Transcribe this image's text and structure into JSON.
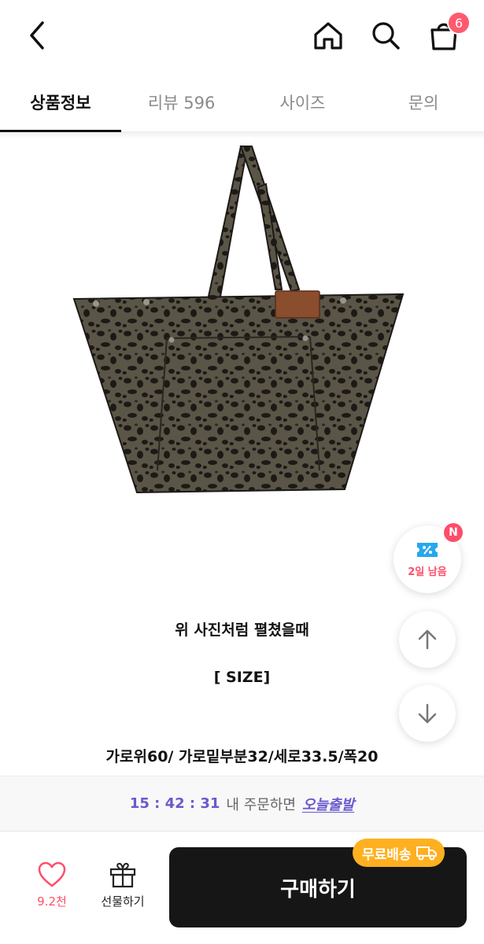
{
  "header": {
    "cart_count": "6",
    "icons": [
      "back-arrow-icon",
      "home-icon",
      "search-icon",
      "shopping-bag-icon"
    ]
  },
  "tabs": [
    {
      "label": "상품정보",
      "active": true
    },
    {
      "label": "리뷰 596",
      "active": false
    },
    {
      "label": "사이즈",
      "active": false
    },
    {
      "label": "문의",
      "active": false
    }
  ],
  "coupon": {
    "badge": "N",
    "label": "2일 남음",
    "icon": "coupon-percent-icon"
  },
  "floating": {
    "scroll_up_icon": "arrow-up-icon",
    "scroll_down_icon": "arrow-down-icon"
  },
  "description": {
    "line1": "위 사진처럼 펼쳤을때",
    "line2": "[ SIZE]",
    "line3": "가로위60/ 가로밑부분32/세로33.5/폭20"
  },
  "shipping": {
    "time": "15 : 42 : 31",
    "text": "내 주문하면",
    "today": "오늘출발"
  },
  "bottom": {
    "like_count": "9.2천",
    "gift_label": "선물하기",
    "buy_label": "구매하기",
    "free_shipping": "무료배송"
  },
  "colors": {
    "accent_pink": "#ff4d6a",
    "accent_purple": "#6a5acd",
    "free_ship_orange": "#ffb020",
    "buy_button": "#161616"
  }
}
